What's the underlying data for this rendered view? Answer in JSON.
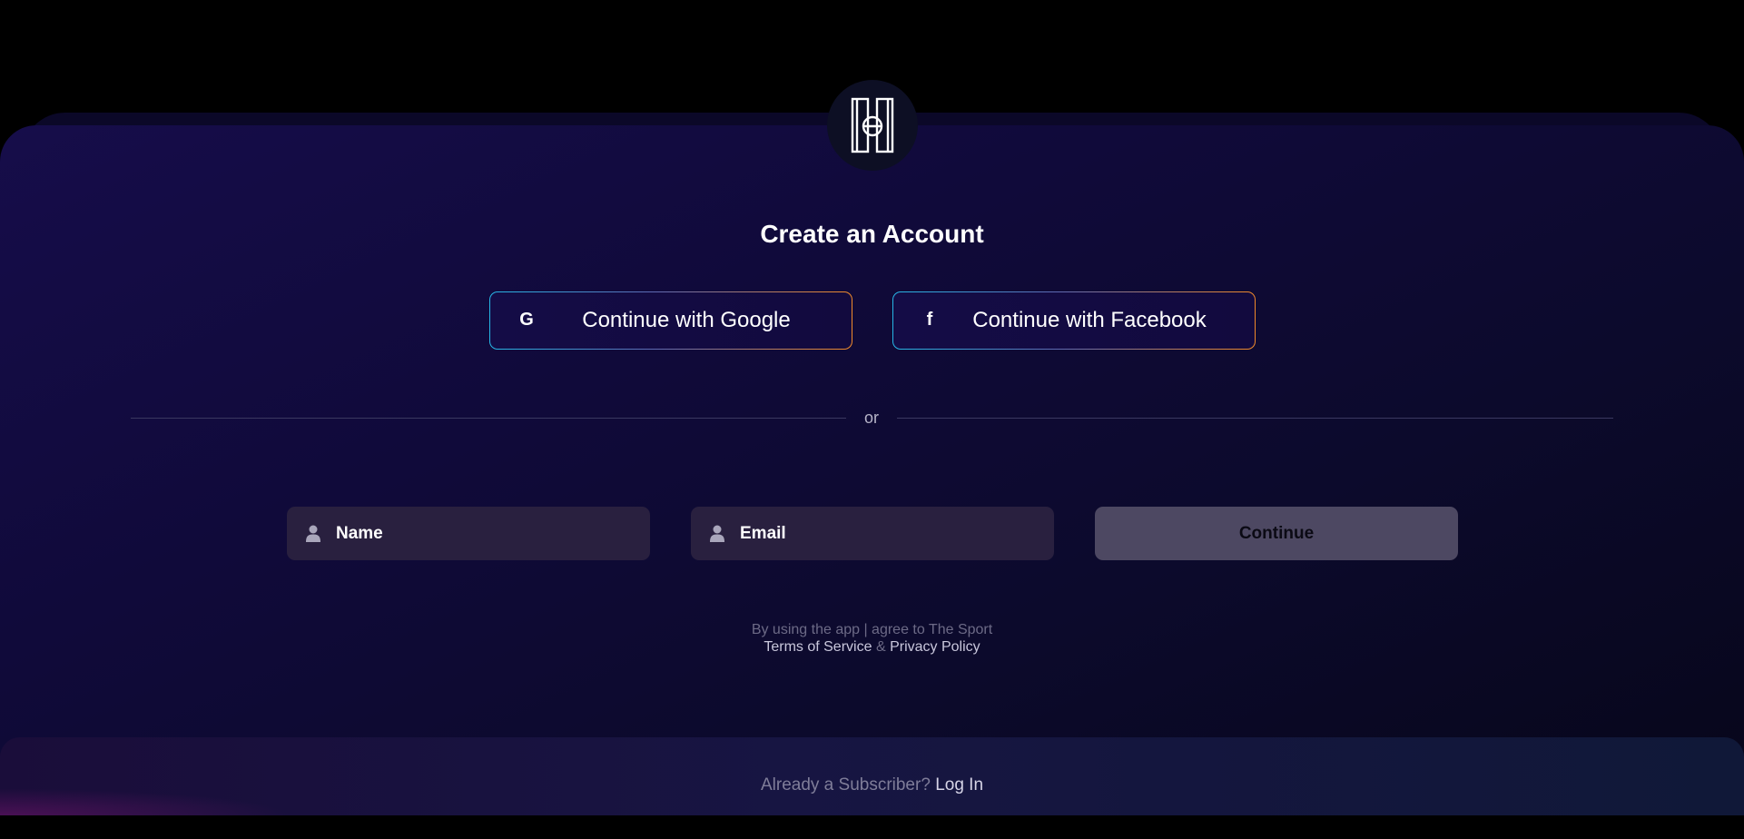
{
  "page": {
    "title": "Create an Account"
  },
  "social": {
    "google": {
      "label": "Continue with Google",
      "icon": "google-g-icon"
    },
    "facebook": {
      "label": "Continue with Facebook",
      "icon": "facebook-f-icon"
    }
  },
  "divider": {
    "text": "or"
  },
  "form": {
    "name": {
      "value": "",
      "placeholder": "Name",
      "icon": "user-icon"
    },
    "email": {
      "value": "",
      "placeholder": "Email",
      "icon": "user-icon"
    },
    "continue_label": "Continue"
  },
  "legal": {
    "line1": "By using the app | agree to The Sport",
    "terms_label": "Terms of Service",
    "amp": "&",
    "privacy_label": "Privacy Policy"
  },
  "footer": {
    "prompt": "Already a Subscriber?",
    "login_label": "Log In"
  },
  "colors": {
    "background": "#000000",
    "card": "#140c46",
    "field": "#29203f",
    "continue_disabled": "#4d4862",
    "border_gradient_start": "#27b6e6",
    "border_gradient_end": "#f08a2a"
  }
}
